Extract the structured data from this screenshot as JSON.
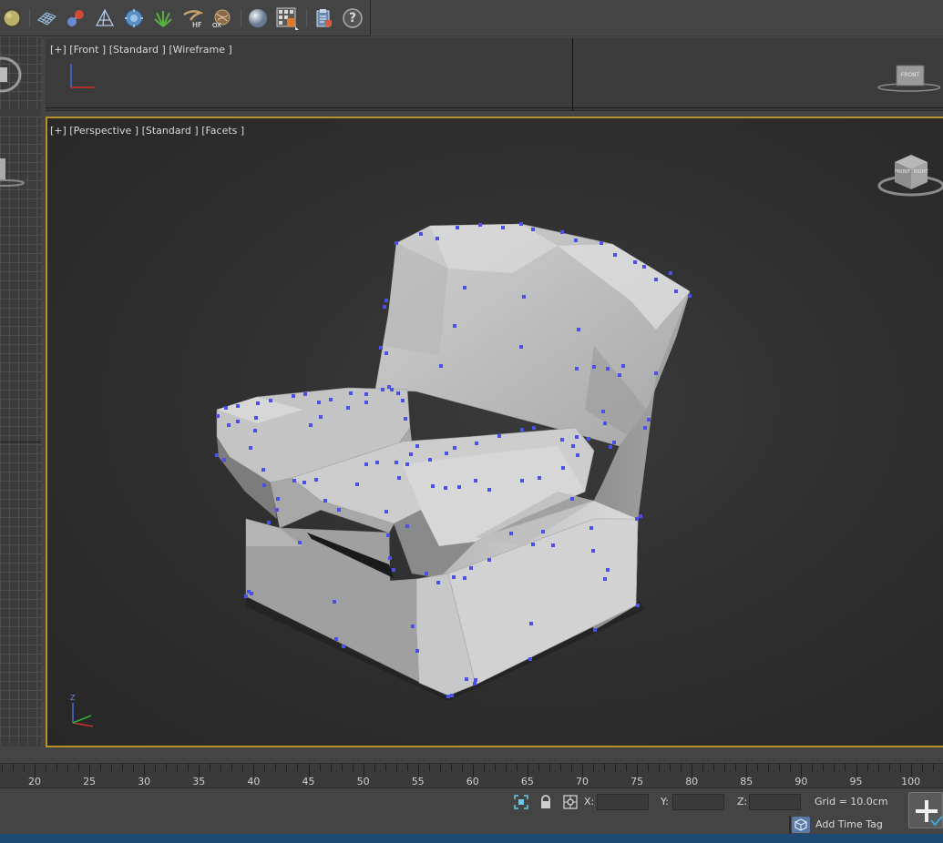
{
  "toolbar": {
    "buttons": [
      {
        "name": "sphere-primitive-icon"
      },
      {
        "name": "geosphere-grid-icon"
      },
      {
        "name": "molecule-icon"
      },
      {
        "name": "pyramid-wireframe-icon"
      },
      {
        "name": "gear-sphere-icon"
      },
      {
        "name": "grass-icon"
      },
      {
        "name": "hair-fur-icon",
        "badge": "HF"
      },
      {
        "name": "ox-object-icon",
        "badge": "OX"
      },
      {
        "name": "material-sphere-icon"
      },
      {
        "name": "material-editor-icon"
      },
      {
        "name": "clipboard-icon"
      },
      {
        "name": "help-icon",
        "glyph": "?"
      }
    ]
  },
  "viewports": {
    "front": {
      "label": "[+] [Front ] [Standard ] [Wireframe ]",
      "viewcube_label": "FRONT"
    },
    "perspective": {
      "label": "[+] [Perspective ] [Standard ] [Facets ]",
      "viewcube_labels": [
        "FRONT",
        "RIGHT"
      ],
      "axis_label": "Z"
    }
  },
  "timeline": {
    "ticks": [
      "20",
      "25",
      "30",
      "35",
      "40",
      "45",
      "50",
      "55",
      "60",
      "65",
      "70",
      "75",
      "80",
      "85",
      "90",
      "95",
      "100"
    ]
  },
  "status": {
    "x_label": "X:",
    "y_label": "Y:",
    "z_label": "Z:",
    "x_value": "",
    "y_value": "",
    "z_value": "",
    "grid_text": "Grid = 10.0cm",
    "add_time_tag": "Add Time Tag"
  },
  "colors": {
    "active_border": "#b8912a",
    "vertex": "#4a50e8",
    "mesh": "#c8c8c8",
    "taskbar": "#1d4a72"
  }
}
